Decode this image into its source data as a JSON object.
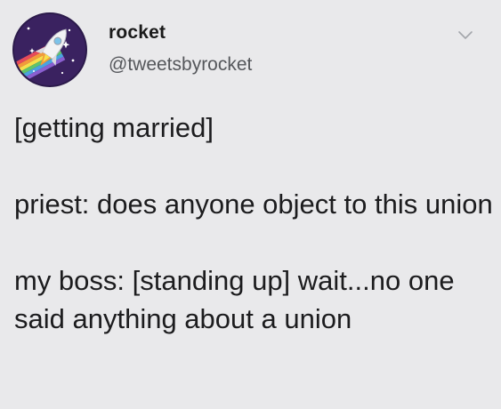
{
  "tweet": {
    "author": {
      "display_name": "rocket",
      "handle": "@tweetsbyrocket",
      "avatar_icon": "rocket-icon"
    },
    "menu_icon": "chevron-down-icon",
    "paragraphs": [
      "[getting married]",
      "priest: does anyone object to this union",
      "my boss: [standing up] wait...no one said anything about a union"
    ]
  },
  "colors": {
    "background": "#e9e9eb",
    "text": "#1c1c1e",
    "handle": "#55575b",
    "caret": "#a3a6ab"
  }
}
